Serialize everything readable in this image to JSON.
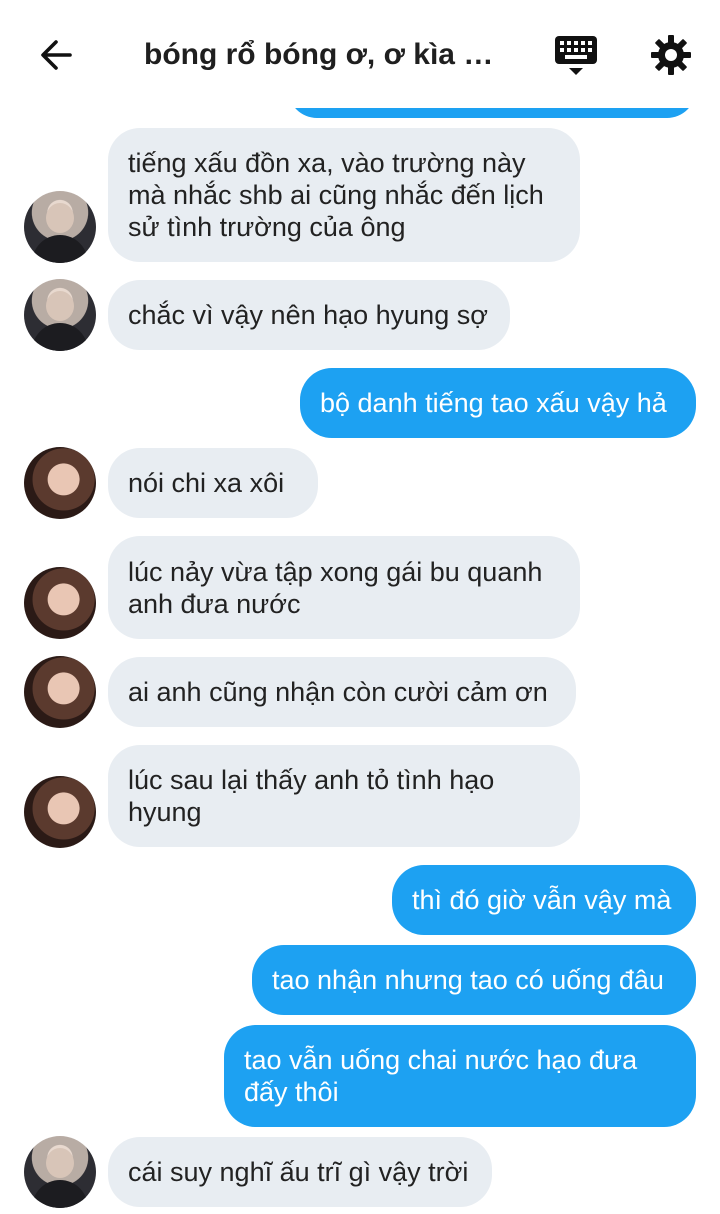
{
  "header": {
    "title": "bóng rổ bóng ơ, ơ kìa b..."
  },
  "messages": [
    {
      "side": "in",
      "avatar": "a",
      "text": "tiếng xấu đồn xa, vào trường này mà nhắc shb ai cũng nhắc đến lịch sử tình trường của ông"
    },
    {
      "side": "in",
      "avatar": "a",
      "text": "chắc vì vậy nên hạo hyung sợ"
    },
    {
      "side": "out",
      "text": "bộ danh tiếng tao xấu vậy hả"
    },
    {
      "side": "in",
      "avatar": "b",
      "text": "nói chi xa xôi"
    },
    {
      "side": "in",
      "avatar": "b",
      "text": "lúc nảy vừa tập xong gái bu quanh anh đưa nước"
    },
    {
      "side": "in",
      "avatar": "b",
      "text": "ai anh cũng nhận còn cười cảm ơn"
    },
    {
      "side": "in",
      "avatar": "b",
      "text": "lúc sau lại thấy anh tỏ tình hạo hyung"
    },
    {
      "side": "out",
      "text": "thì đó giờ vẫn vậy mà"
    },
    {
      "side": "out",
      "text": "tao nhận nhưng tao có uống đâu"
    },
    {
      "side": "out",
      "text": "tao vẫn uống chai nước hạo đưa đấy thôi"
    },
    {
      "side": "in",
      "avatar": "a",
      "text": "cái suy nghĩ ấu trĩ gì vậy trời"
    }
  ],
  "colors": {
    "outgoing_bubble": "#1da1f2",
    "incoming_bubble": "#e8edf2"
  },
  "icons": [
    "back-arrow-icon",
    "keyboard-icon",
    "gear-icon"
  ]
}
